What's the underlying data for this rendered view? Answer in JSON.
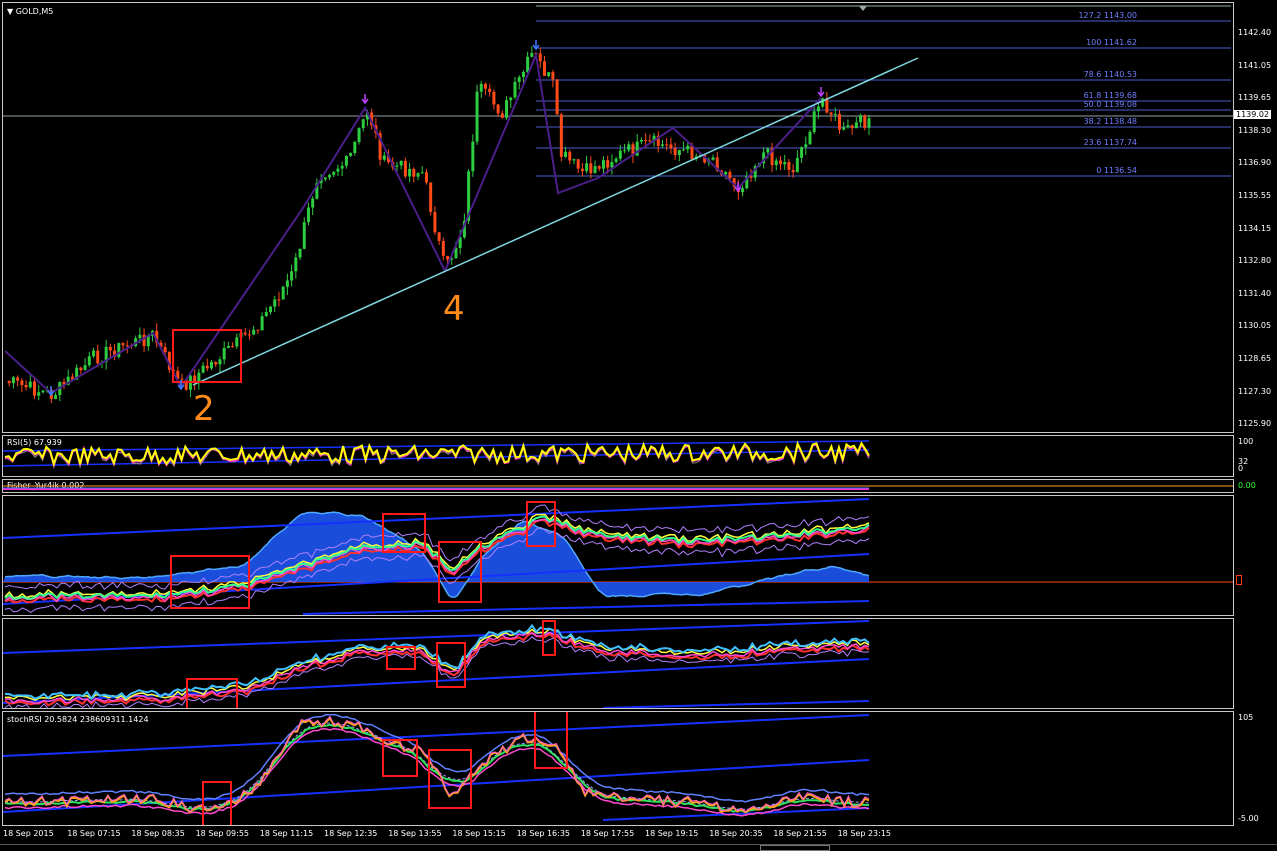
{
  "main_pane": {
    "symbol_label": "GOLD,M5",
    "current_price": "1139.02",
    "price_ticks": [
      "1142.40",
      "1141.05",
      "1139.65",
      "1138.30",
      "1136.90",
      "1135.55",
      "1134.15",
      "1132.80",
      "1131.40",
      "1130.05",
      "1128.65",
      "1127.30",
      "1125.90"
    ],
    "fib_levels": [
      {
        "label": "127.2 1143.00"
      },
      {
        "label": "100 1141.62"
      },
      {
        "label": "78.6 1140.53"
      },
      {
        "label": "61.8 1139.68"
      },
      {
        "label": "50.0 1139.08"
      },
      {
        "label": "38.2 1138.48"
      },
      {
        "label": "23.6 1137.74"
      },
      {
        "label": "0 1136.54"
      }
    ],
    "wave_labels": [
      "2",
      "4"
    ]
  },
  "rsi_pane": {
    "label": "RSI(5) 67.939",
    "ticks": [
      "100",
      "32",
      "0"
    ]
  },
  "fisher_pane": {
    "label": "Fisher_Yur4ik 0.002",
    "tick": "0.00"
  },
  "stoch_pane": {
    "label": "stochRSI 20.5824 238609311.1424",
    "ticks": [
      "105",
      "-5.00"
    ]
  },
  "time_axis": [
    "18 Sep 2015",
    "18 Sep 07:15",
    "18 Sep 08:35",
    "18 Sep 09:55",
    "18 Sep 11:15",
    "18 Sep 12:35",
    "18 Sep 13:55",
    "18 Sep 15:15",
    "18 Sep 16:35",
    "18 Sep 17:55",
    "18 Sep 19:15",
    "18 Sep 20:35",
    "18 Sep 21:55",
    "18 Sep 23:15"
  ],
  "colors": {
    "bull": "#2ecc40",
    "bear": "#ff4a1a",
    "zigzag": "#4b1f8a",
    "trendline": "#7fd8e0",
    "fib": "#4b5ccc",
    "highlight_box": "#ff1a1a",
    "rsi_line": "#ffff00",
    "band_blue": "#1530ff"
  }
}
